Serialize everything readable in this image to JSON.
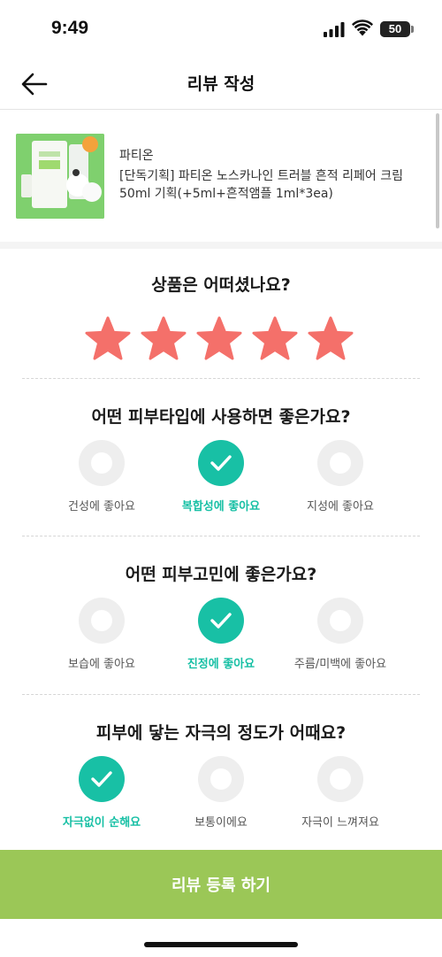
{
  "status_bar": {
    "time": "9:49",
    "battery": "50",
    "battery_level": 0.5
  },
  "header": {
    "title": "리뷰 작성"
  },
  "product": {
    "brand": "파티온",
    "name": "[단독기획] 파티온 노스카나인 트러블 흔적 리페어 크림 50ml 기획(+5ml+흔적앰플 1ml*3ea)"
  },
  "rating": {
    "question": "상품은 어떠셨나요?",
    "value": 5,
    "max": 5,
    "star_color": "#f4706a"
  },
  "skin_type": {
    "question": "어떤 피부타입에 사용하면 좋은가요?",
    "options": [
      "건성에 좋아요",
      "복합성에 좋아요",
      "지성에 좋아요"
    ],
    "selected": 1
  },
  "skin_concern": {
    "question": "어떤 피부고민에 좋은가요?",
    "options": [
      "보습에 좋아요",
      "진정에 좋아요",
      "주름/미백에 좋아요"
    ],
    "selected": 1
  },
  "irritation": {
    "question": "피부에 닿는 자극의 정도가 어때요?",
    "options": [
      "자극없이 순해요",
      "보통이에요",
      "자극이 느껴져요"
    ],
    "selected": 0
  },
  "submit": {
    "label": "리뷰 등록 하기"
  },
  "colors": {
    "accent": "#18c0a5",
    "submit_bg": "#9bc757",
    "star": "#f4706a"
  }
}
